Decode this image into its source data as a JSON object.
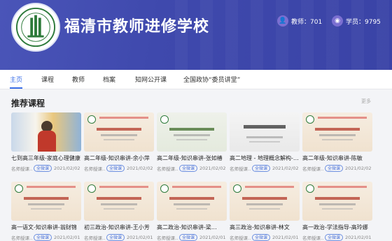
{
  "header": {
    "site_title": "福清市教师进修学校",
    "stats": [
      {
        "icon": "teacher-icon",
        "label": "教师：701"
      },
      {
        "icon": "student-icon",
        "label": "学员：9795"
      }
    ]
  },
  "nav": {
    "items": [
      "主页",
      "课程",
      "教师",
      "档案",
      "知网公开课",
      "全国政协“委员讲堂”"
    ],
    "active": "主页"
  },
  "section": {
    "title": "推荐课程",
    "more": "更多"
  },
  "courses": [
    {
      "title": "七到高三年级-家庭心理健康",
      "author": "名师授课…",
      "tag": "全微课",
      "date": "2021/02/02"
    },
    {
      "title": "高二年级-知识串讲-余小萍",
      "author": "名师授课…",
      "tag": "全微课",
      "date": "2021/02/02"
    },
    {
      "title": "高二年级-知识串讲-张如椿",
      "author": "名师授课…",
      "tag": "全微课",
      "date": "2021/02/02"
    },
    {
      "title": "高二地理 - 地理概念解构-…",
      "author": "名师授课…",
      "tag": "全微课",
      "date": "2021/02/02"
    },
    {
      "title": "高二年级-知识串讲-陈敏",
      "author": "名师授课…",
      "tag": "全微课",
      "date": "2021/02/02"
    },
    {
      "title": "高一语文-知识串讲-翁财锦",
      "author": "名师授课…",
      "tag": "全微课",
      "date": "2021/02/01"
    },
    {
      "title": "初三政治-知识串讲-王小芳",
      "author": "名师授课…",
      "tag": "全微课",
      "date": "2021/02/01"
    },
    {
      "title": "高二政治-知识串讲-梁…",
      "author": "名师授课…",
      "tag": "全微课",
      "date": "2021/02/01"
    },
    {
      "title": "高三政治-知识串讲-林文",
      "author": "名师授课…",
      "tag": "全微课",
      "date": "2021/02/01"
    },
    {
      "title": "高一政治-学法指导-高玲娜",
      "author": "名师授课…",
      "tag": "全微课",
      "date": "2021/02/01"
    }
  ],
  "colors": {
    "banner": "#3f49ad",
    "accent": "#3a6ee8"
  }
}
